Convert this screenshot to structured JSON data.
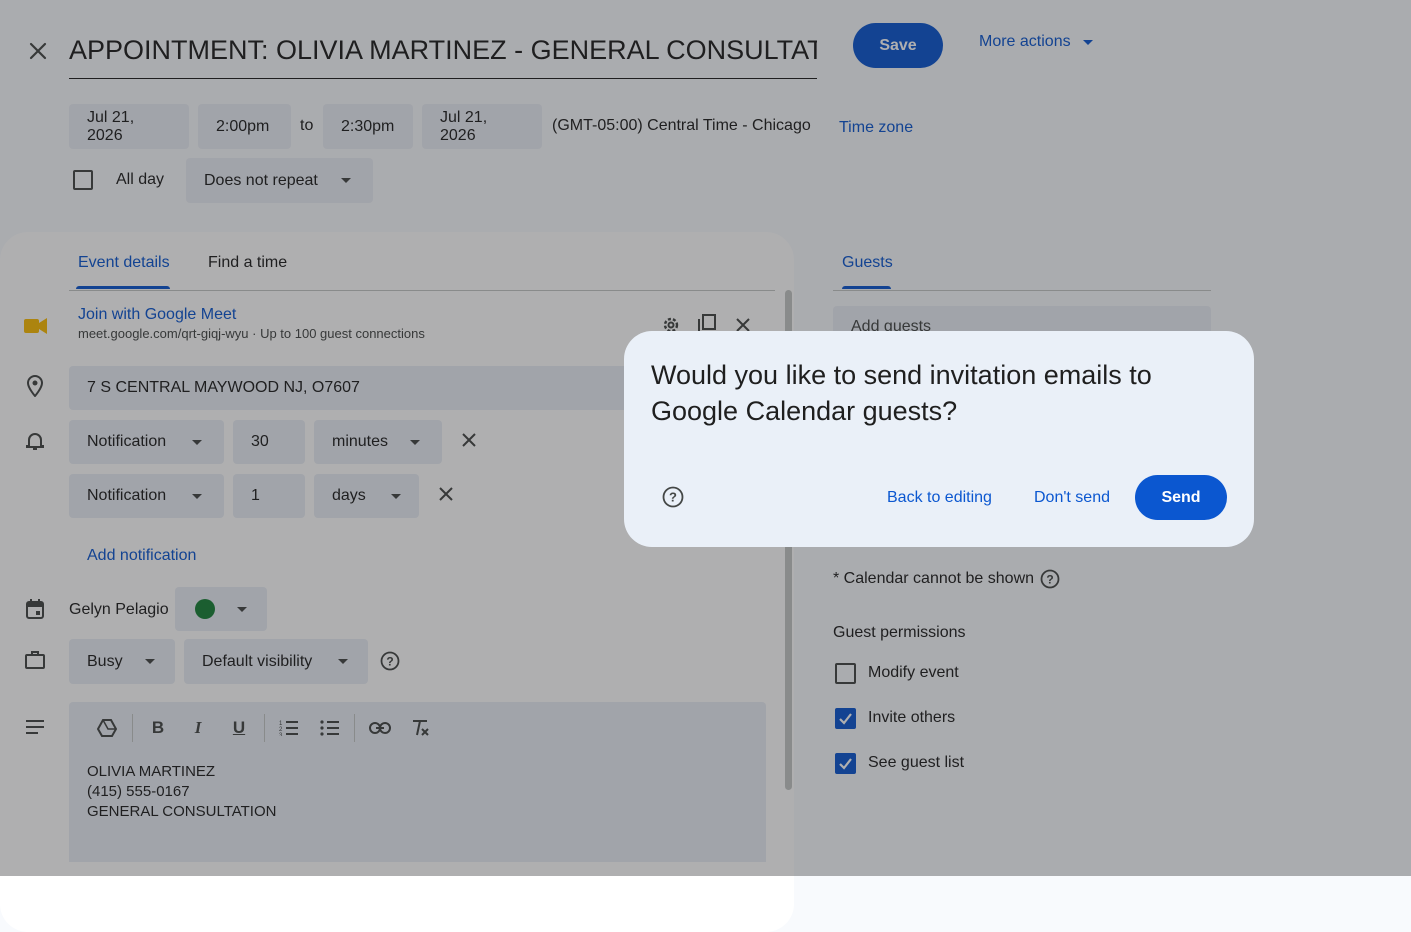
{
  "header": {
    "title": "APPOINTMENT: OLIVIA MARTINEZ - GENERAL CONSULTATION",
    "save_label": "Save",
    "more_actions_label": "More actions"
  },
  "datetime": {
    "start_date": "Jul 21, 2026",
    "start_time": "2:00pm",
    "to_label": "to",
    "end_time": "2:30pm",
    "end_date": "Jul 21, 2026",
    "timezone_text": "(GMT-05:00) Central Time - Chicago",
    "timezone_link": "Time zone",
    "all_day_label": "All day",
    "repeat_value": "Does not repeat"
  },
  "tabs": {
    "event_details": "Event details",
    "find_time": "Find a time",
    "guests": "Guests"
  },
  "meet": {
    "join_label": "Join with Google Meet",
    "info": "meet.google.com/qrt-giqj-wyu · Up to 100 guest connections"
  },
  "location": {
    "value": "7 S CENTRAL MAYWOOD NJ, O7607"
  },
  "notifications": [
    {
      "type": "Notification",
      "amount": "30",
      "unit": "minutes"
    },
    {
      "type": "Notification",
      "amount": "1",
      "unit": "days"
    }
  ],
  "add_notification_label": "Add notification",
  "calendar": {
    "owner": "Gelyn Pelagio",
    "color": "#188038"
  },
  "availability": {
    "status": "Busy",
    "visibility": "Default visibility"
  },
  "description": {
    "lines": [
      "OLIVIA MARTINEZ",
      "(415) 555-0167",
      "GENERAL CONSULTATION"
    ]
  },
  "guests": {
    "add_placeholder": "Add guests",
    "calendar_note": "* Calendar cannot be shown",
    "permissions_title": "Guest permissions",
    "permissions": [
      {
        "label": "Modify event",
        "checked": false
      },
      {
        "label": "Invite others",
        "checked": true
      },
      {
        "label": "See guest list",
        "checked": true
      }
    ]
  },
  "dialog": {
    "message": "Would you like to send invitation emails to Google Calendar guests?",
    "back_label": "Back to editing",
    "dont_send_label": "Don't send",
    "send_label": "Send"
  },
  "colors": {
    "accent": "#0b57d0",
    "chip_bg": "#e9eef6",
    "check_on": "#0b57d0"
  }
}
